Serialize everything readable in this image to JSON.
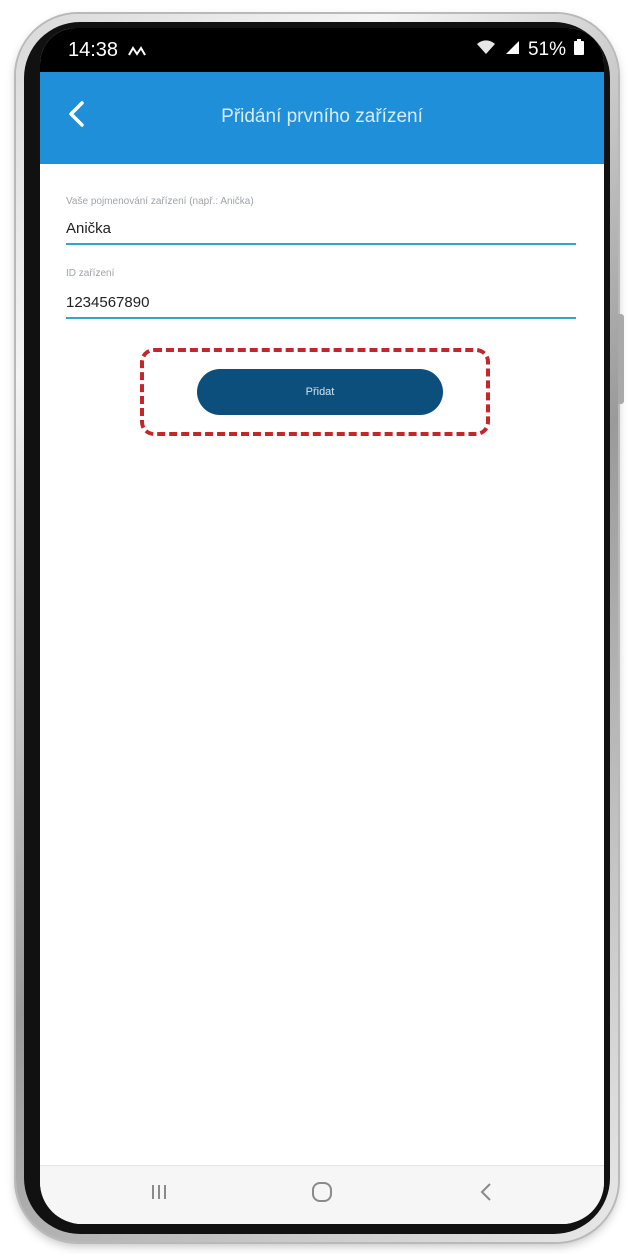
{
  "status_bar": {
    "time": "14:38",
    "battery": "51%"
  },
  "app_bar": {
    "title": "Přidání prvního zařízení",
    "back_icon": "chevron-left-icon"
  },
  "form": {
    "name_field": {
      "label": "Vaše pojmenování zařízení (např.: Anička)",
      "value": "Anička"
    },
    "id_field": {
      "label": "ID zařízení",
      "value": "1234567890"
    },
    "add_button_label": "Přidat"
  },
  "nav_bar": {
    "items": [
      "recents-icon",
      "home-icon",
      "back-icon"
    ]
  },
  "colors": {
    "app_bar": "#1e8fd8",
    "button": "#0d4f7c",
    "underline": "#2fa7c5",
    "highlight": "#c4272b"
  }
}
